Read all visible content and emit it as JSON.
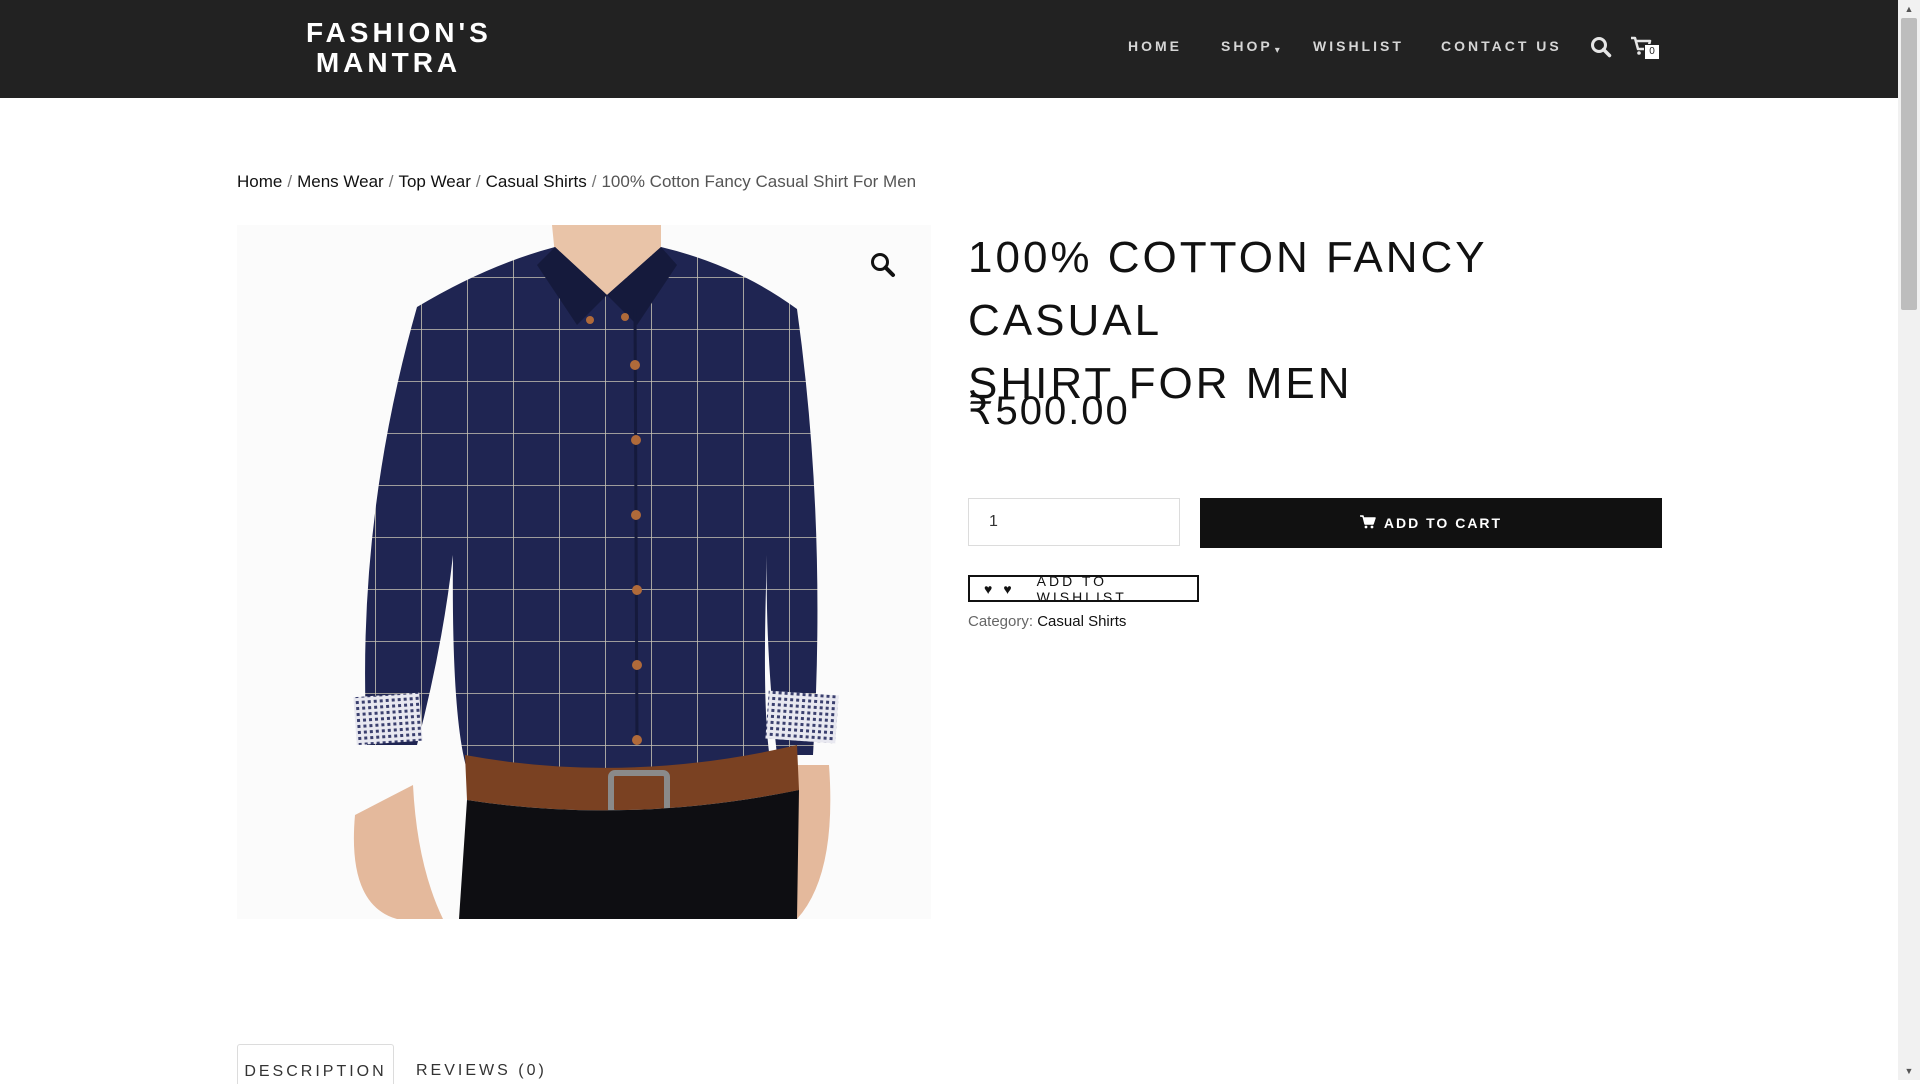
{
  "header": {
    "logo_line1": "FASHION'S",
    "logo_line2": "MANTRA",
    "nav": {
      "home": "HOME",
      "shop": "SHOP",
      "wishlist": "WISHLIST",
      "contact": "CONTACT US"
    },
    "search_icon": "search-icon",
    "cart_icon": "cart-icon",
    "cart_count": "0"
  },
  "breadcrumb": {
    "home": "Home",
    "mens_wear": "Mens Wear",
    "top_wear": "Top Wear",
    "casual_shirts": "Casual Shirts",
    "current": "100% Cotton Fancy Casual Shirt For Men",
    "separator": "/"
  },
  "product": {
    "title_line1": "100% COTTON FANCY CASUAL",
    "title_line2": "SHIRT FOR MEN",
    "price": "₹500.00",
    "quantity": "1",
    "add_to_cart": "ADD TO CART",
    "add_to_wishlist": "ADD TO WISHLIST",
    "category_label": "Category:",
    "category_value": "Casual Shirts",
    "zoom_icon": "magnifier-icon"
  },
  "tabs": {
    "description": "DESCRIPTION",
    "reviews": "REVIEWS (0)"
  },
  "colors": {
    "header_bg": "#222222",
    "button_bg": "#111111",
    "shirt_navy": "#1f2552"
  }
}
